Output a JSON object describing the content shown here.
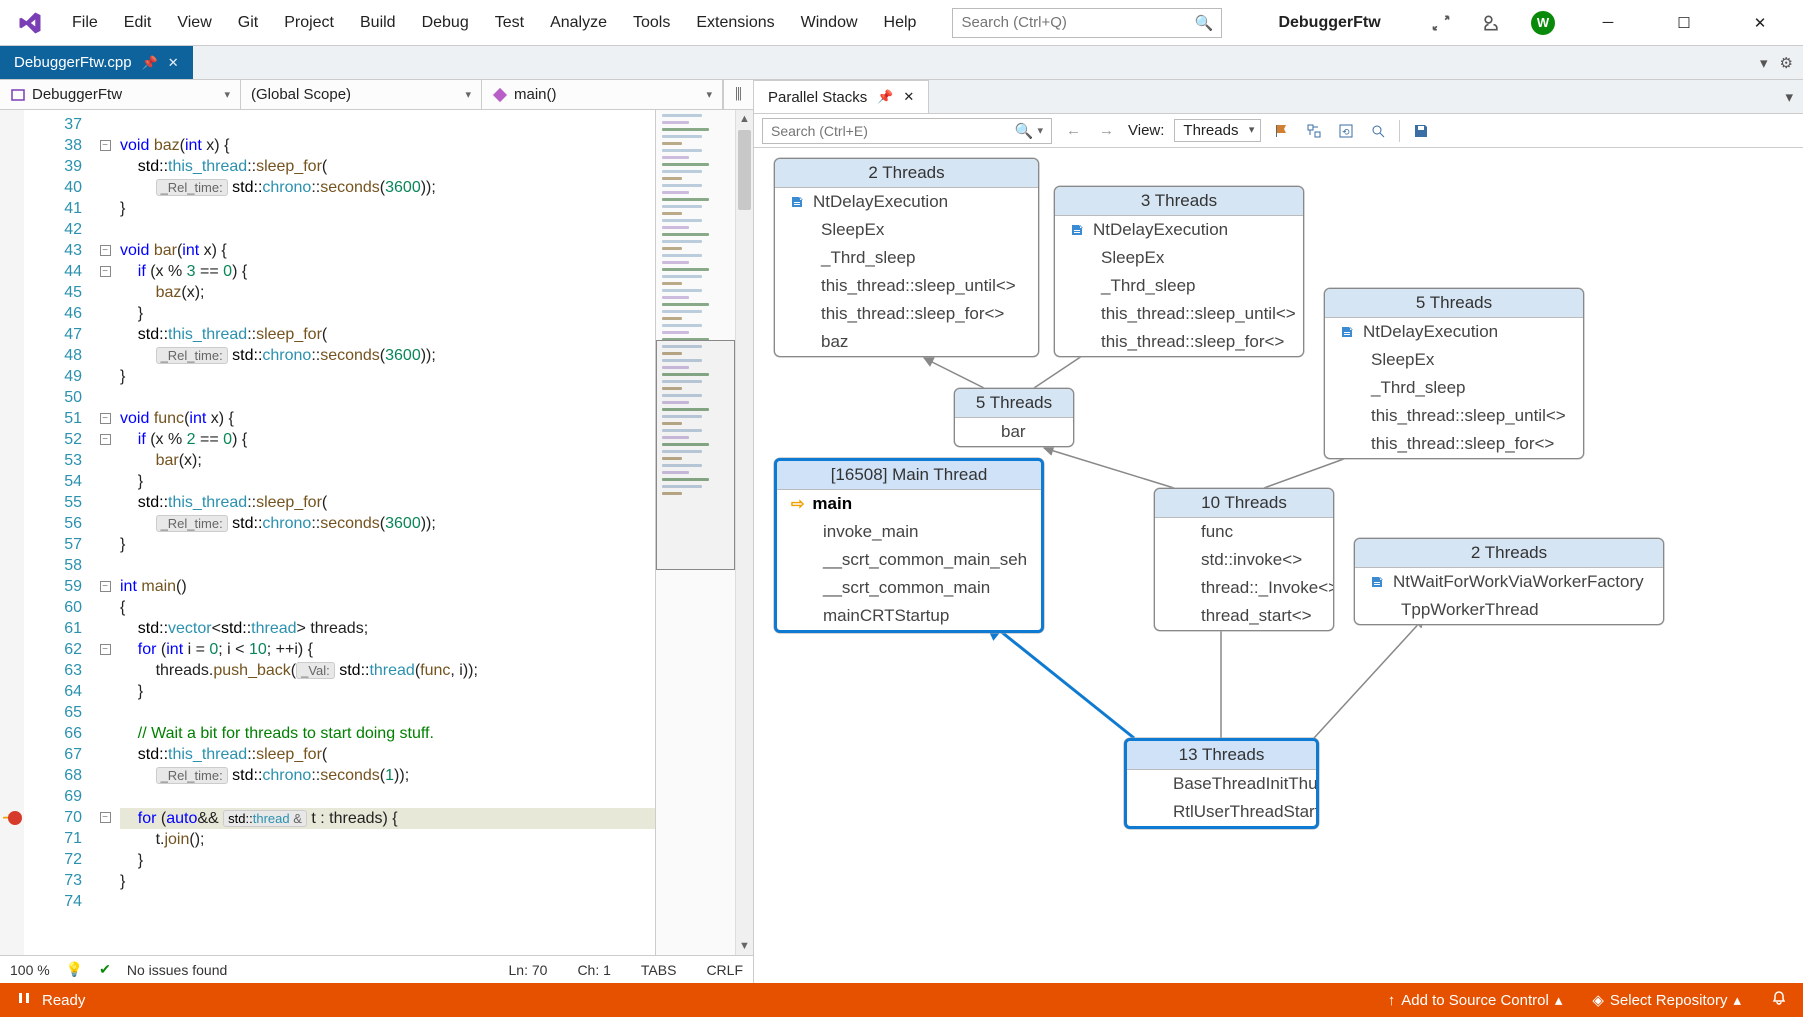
{
  "menu": {
    "items": [
      "File",
      "Edit",
      "View",
      "Git",
      "Project",
      "Build",
      "Debug",
      "Test",
      "Analyze",
      "Tools",
      "Extensions",
      "Window",
      "Help"
    ]
  },
  "title_search_placeholder": "Search (Ctrl+Q)",
  "project_name": "DebuggerFtw",
  "user_initial": "W",
  "doc_tab": {
    "name": "DebuggerFtw.cpp"
  },
  "scopes": {
    "project": "DebuggerFtw",
    "scope": "(Global Scope)",
    "func": "main()"
  },
  "code_start_line": 37,
  "code_lines": [
    "",
    "void baz(int x) {",
    "    std::this_thread::sleep_for(",
    "        _Rel_time: std::chrono::seconds(3600));",
    "}",
    "",
    "void bar(int x) {",
    "    if (x % 3 == 0) {",
    "        baz(x);",
    "    }",
    "    std::this_thread::sleep_for(",
    "        _Rel_time: std::chrono::seconds(3600));",
    "}",
    "",
    "void func(int x) {",
    "    if (x % 2 == 0) {",
    "        bar(x);",
    "    }",
    "    std::this_thread::sleep_for(",
    "        _Rel_time: std::chrono::seconds(3600));",
    "}",
    "",
    "int main()",
    "{",
    "    std::vector<std::thread> threads;",
    "    for (int i = 0; i < 10; ++i) {",
    "        threads.push_back(_Val: std::thread(func, i));",
    "    }",
    "",
    "    // Wait a bit for threads to start doing stuff.",
    "    std::this_thread::sleep_for(",
    "        _Rel_time: std::chrono::seconds(1));",
    "",
    "    for (auto&& std::thread & t : threads) {",
    "        t.join();",
    "    }",
    "}",
    ""
  ],
  "editor_footer": {
    "zoom": "100 %",
    "issues": "No issues found",
    "line": "Ln: 70",
    "col": "Ch: 1",
    "tabs": "TABS",
    "crlf": "CRLF"
  },
  "parallel_stacks": {
    "tab_title": "Parallel Stacks",
    "search_placeholder": "Search (Ctrl+E)",
    "view_label": "View:",
    "view_value": "Threads",
    "boxes": {
      "b2a": {
        "title": "2 Threads",
        "rows": [
          {
            "t": "NtDelayExecution",
            "i": "frame"
          },
          {
            "t": "SleepEx"
          },
          {
            "t": "_Thrd_sleep"
          },
          {
            "t": "this_thread::sleep_until<>"
          },
          {
            "t": "this_thread::sleep_for<>"
          },
          {
            "t": "baz"
          }
        ]
      },
      "b3": {
        "title": "3 Threads",
        "rows": [
          {
            "t": "NtDelayExecution",
            "i": "frame"
          },
          {
            "t": "SleepEx"
          },
          {
            "t": "_Thrd_sleep"
          },
          {
            "t": "this_thread::sleep_until<>"
          },
          {
            "t": "this_thread::sleep_for<>"
          }
        ]
      },
      "b5top": {
        "title": "5 Threads",
        "rows": [
          {
            "t": "NtDelayExecution",
            "i": "frame"
          },
          {
            "t": "SleepEx"
          },
          {
            "t": "_Thrd_sleep"
          },
          {
            "t": "this_thread::sleep_until<>"
          },
          {
            "t": "this_thread::sleep_for<>"
          }
        ]
      },
      "b5bar": {
        "title": "5 Threads",
        "rows": [
          {
            "t": "bar"
          }
        ]
      },
      "main": {
        "title": "[16508] Main Thread",
        "rows": [
          {
            "t": "main",
            "i": "arrow",
            "cur": true
          },
          {
            "t": "invoke_main"
          },
          {
            "t": "__scrt_common_main_seh"
          },
          {
            "t": "__scrt_common_main"
          },
          {
            "t": "mainCRTStartup"
          }
        ]
      },
      "b10": {
        "title": "10 Threads",
        "rows": [
          {
            "t": "func"
          },
          {
            "t": "std::invoke<>"
          },
          {
            "t": "thread::_Invoke<>"
          },
          {
            "t": "thread_start<>"
          }
        ]
      },
      "b2b": {
        "title": "2 Threads",
        "rows": [
          {
            "t": "NtWaitForWorkViaWorkerFactory",
            "i": "frame"
          },
          {
            "t": "TppWorkerThread"
          }
        ]
      },
      "b13": {
        "title": "13 Threads",
        "rows": [
          {
            "t": "BaseThreadInitThunk"
          },
          {
            "t": "RtlUserThreadStart"
          }
        ]
      }
    }
  },
  "statusbar": {
    "ready": "Ready",
    "add_sc": "Add to Source Control",
    "sel_repo": "Select Repository"
  }
}
